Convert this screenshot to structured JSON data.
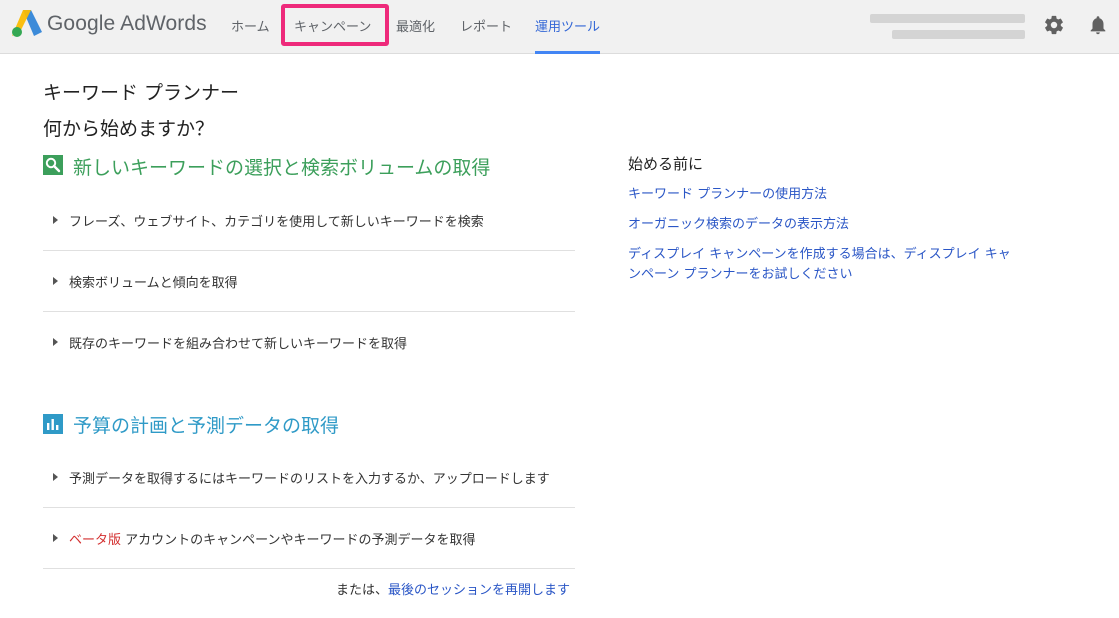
{
  "header": {
    "brand": "Google AdWords",
    "nav": [
      {
        "label": "ホーム"
      },
      {
        "label": "キャンペーン"
      },
      {
        "label": "最適化"
      },
      {
        "label": "レポート"
      },
      {
        "label": "運用ツール"
      }
    ],
    "active_tab": "運用ツール",
    "highlighted_tab": "キャンペーン",
    "icons": [
      "gear-icon",
      "bell-icon"
    ]
  },
  "main": {
    "title": "キーワード プランナー",
    "question": "何から始めますか？",
    "sections": [
      {
        "heading": "新しいキーワードの選択と検索ボリュームの取得",
        "icon": "search-icon",
        "options": [
          {
            "label": "フレーズ、ウェブサイト、カテゴリを使用して新しいキーワードを検索"
          },
          {
            "label": "検索ボリュームと傾向を取得"
          },
          {
            "label": "既存のキーワードを組み合わせて新しいキーワードを取得"
          }
        ]
      },
      {
        "heading": "予算の計画と予測データの取得",
        "icon": "bar-chart-icon",
        "options": [
          {
            "label": "予測データを取得するにはキーワードのリストを入力するか、アップロードします"
          },
          {
            "badge": "ベータ版",
            "label": "アカウントのキャンペーンやキーワードの予測データを取得"
          }
        ]
      }
    ],
    "resume_prefix": "または、",
    "resume_link": "最後のセッションを再開します"
  },
  "sidebar": {
    "title": "始める前に",
    "links": [
      {
        "label": "キーワード プランナーの使用方法"
      },
      {
        "label": "オーガニック検索のデータの表示方法"
      },
      {
        "label": "ディスプレイ キャンペーンを作成する場合は、ディスプレイ キャンペーン プランナーをお試しください"
      }
    ]
  },
  "colors": {
    "section_green": "#3c9f5b",
    "section_teal": "#2f9ac7",
    "link_blue": "#2a56c6",
    "active_tab_blue": "#4285f4",
    "highlight_pink": "#ee2a7b",
    "beta_red": "#d32f2f"
  }
}
